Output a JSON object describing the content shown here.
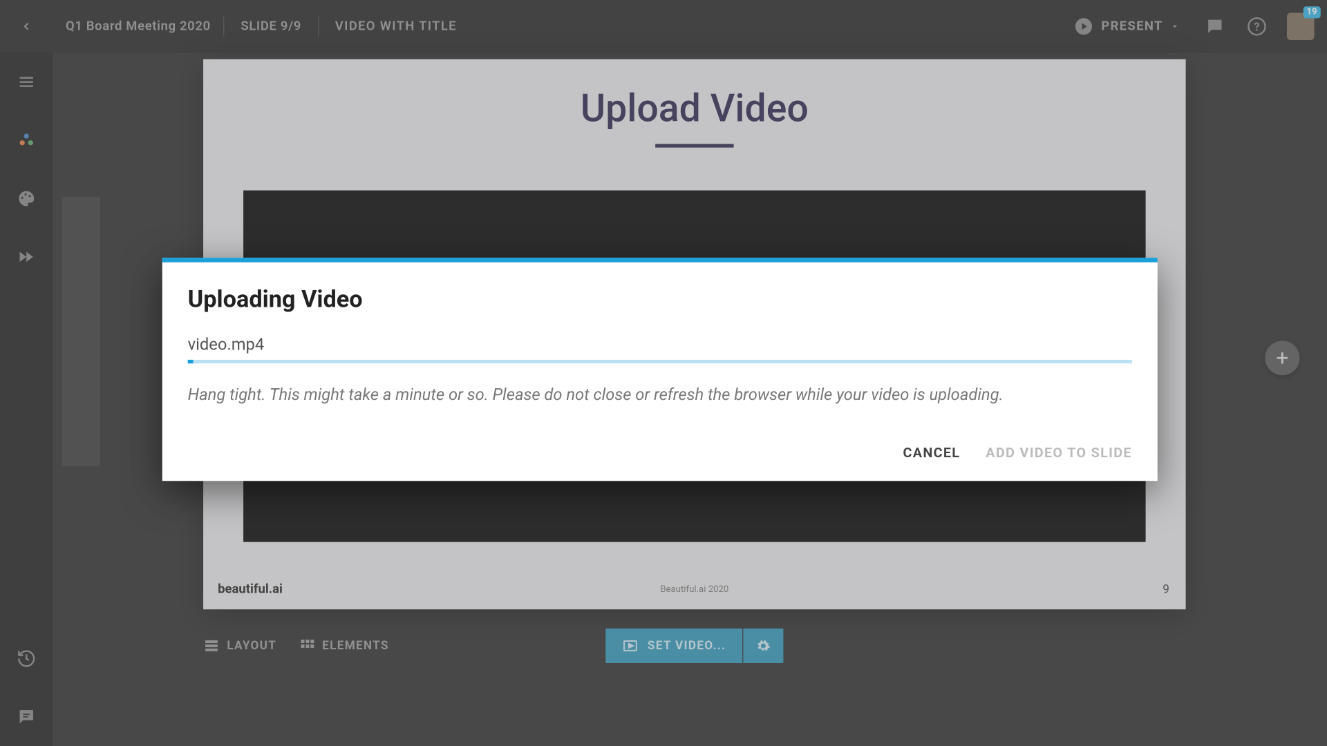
{
  "header": {
    "title": "Q1 Board Meeting 2020",
    "slide_indicator": "SLIDE 9/9",
    "template_name": "VIDEO WITH TITLE",
    "present_label": "PRESENT",
    "notif_count": "19"
  },
  "slide": {
    "title": "Upload Video",
    "branding": "beautiful.ai",
    "footer": "Beautiful.ai 2020",
    "page_number": "9"
  },
  "toolbar": {
    "layout_label": "LAYOUT",
    "elements_label": "ELEMENTS",
    "set_video_label": "SET VIDEO..."
  },
  "dialog": {
    "title": "Uploading Video",
    "filename": "video.mp4",
    "message": "Hang tight. This might take a minute or so. Please do not close or refresh the browser while your video is uploading.",
    "cancel_label": "CANCEL",
    "add_label": "ADD VIDEO TO SLIDE"
  }
}
